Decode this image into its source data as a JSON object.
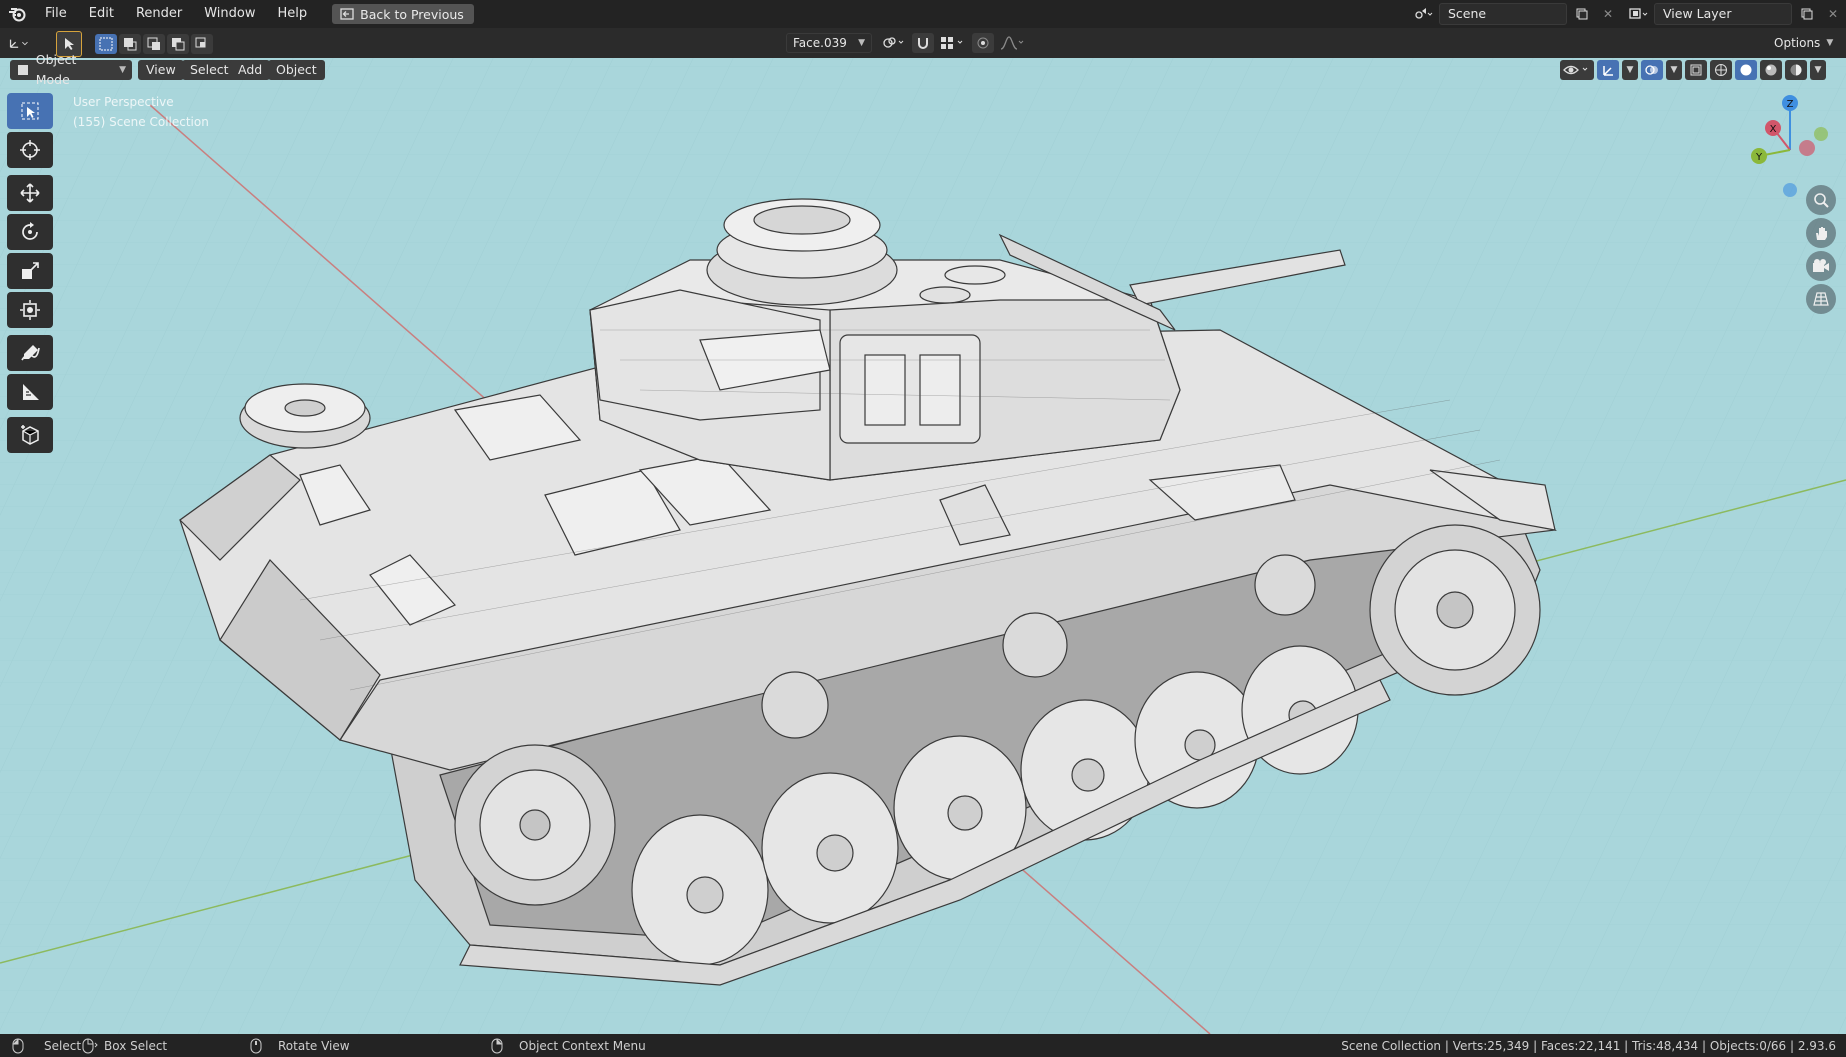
{
  "topbar": {
    "menus": [
      "File",
      "Edit",
      "Render",
      "Window",
      "Help"
    ],
    "back_button": "Back to Previous",
    "scene_name": "Scene",
    "view_layer_name": "View Layer"
  },
  "toolbar": {
    "active_object": "Face.039",
    "options_label": "Options"
  },
  "viewport_header": {
    "mode": "Object Mode",
    "menus": [
      "View",
      "Select",
      "Add",
      "Object"
    ]
  },
  "viewport": {
    "perspective_label": "User Perspective",
    "collection_label": "(155) Scene Collection",
    "background_color": "#a9d6db",
    "gizmo_axes": {
      "x": "X",
      "y": "Y",
      "z": "Z"
    },
    "axis_colors": {
      "x": "#d1566a",
      "y": "#8bb83a",
      "z": "#3f8fe0"
    }
  },
  "tools": [
    "select-box",
    "cursor",
    "move",
    "rotate",
    "scale",
    "transform",
    "annotate",
    "measure",
    "add-cube"
  ],
  "statusbar": {
    "select": "Select",
    "box_select": "Box Select",
    "rotate_view": "Rotate View",
    "context_menu": "Object Context Menu",
    "stats": "Scene Collection | Verts:25,349 | Faces:22,141 | Tris:48,434 | Objects:0/66 | 2.93.6"
  }
}
